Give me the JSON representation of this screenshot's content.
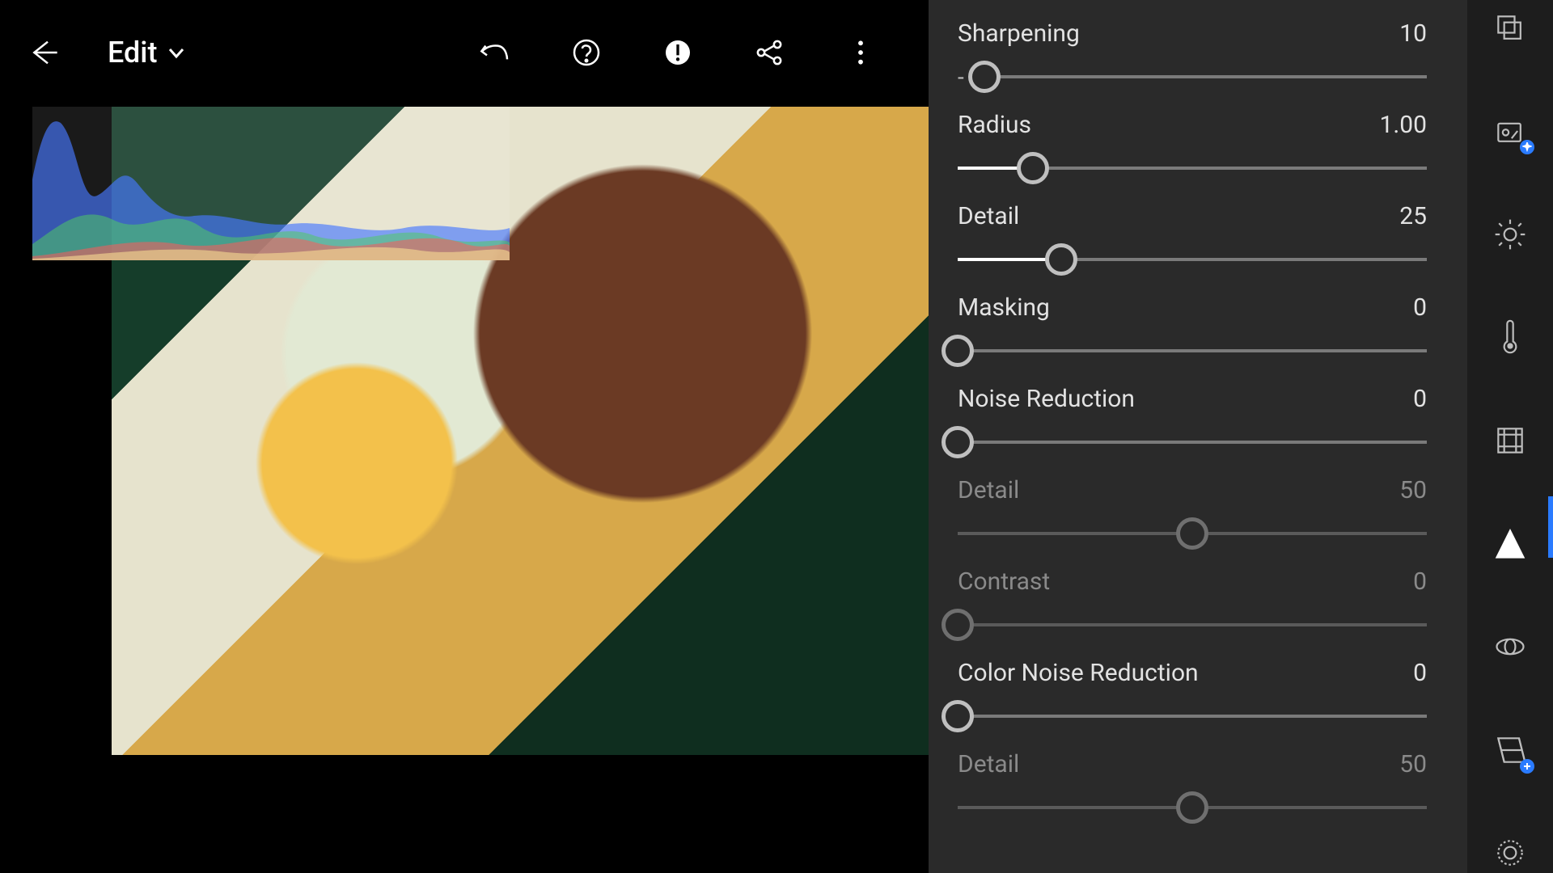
{
  "header": {
    "mode_label": "Edit"
  },
  "sliders": [
    {
      "id": "sharpening",
      "label": "Sharpening",
      "value": "10",
      "pct": 3,
      "fill_pct": 3,
      "has_neg": true,
      "disabled": false
    },
    {
      "id": "radius",
      "label": "Radius",
      "value": "1.00",
      "pct": 16,
      "fill_pct": 16,
      "has_neg": false,
      "disabled": false
    },
    {
      "id": "detail-sharp",
      "label": "Detail",
      "value": "25",
      "pct": 22,
      "fill_pct": 22,
      "has_neg": false,
      "disabled": false
    },
    {
      "id": "masking",
      "label": "Masking",
      "value": "0",
      "pct": 0,
      "fill_pct": 0,
      "has_neg": false,
      "disabled": false
    },
    {
      "id": "noise-reduction",
      "label": "Noise Reduction",
      "value": "0",
      "pct": 0,
      "fill_pct": 0,
      "has_neg": false,
      "disabled": false
    },
    {
      "id": "detail-nr",
      "label": "Detail",
      "value": "50",
      "pct": 50,
      "fill_pct": 0,
      "has_neg": false,
      "disabled": true
    },
    {
      "id": "contrast-nr",
      "label": "Contrast",
      "value": "0",
      "pct": 0,
      "fill_pct": 0,
      "has_neg": false,
      "disabled": true
    },
    {
      "id": "color-noise-reduction",
      "label": "Color Noise Reduction",
      "value": "0",
      "pct": 0,
      "fill_pct": 0,
      "has_neg": false,
      "disabled": false
    },
    {
      "id": "detail-cnr",
      "label": "Detail",
      "value": "50",
      "pct": 50,
      "fill_pct": 0,
      "has_neg": false,
      "disabled": true
    }
  ],
  "tools": [
    {
      "id": "filmstrip",
      "name": "filmstrip-icon",
      "active": false,
      "badge": null
    },
    {
      "id": "auto",
      "name": "auto-enhance-icon",
      "active": false,
      "badge": "sparkle"
    },
    {
      "id": "light",
      "name": "light-icon",
      "active": false,
      "badge": null
    },
    {
      "id": "color",
      "name": "color-temp-icon",
      "active": false,
      "badge": null
    },
    {
      "id": "crop",
      "name": "crop-icon",
      "active": false,
      "badge": null
    },
    {
      "id": "detail",
      "name": "detail-icon",
      "active": true,
      "badge": null
    },
    {
      "id": "optics",
      "name": "optics-icon",
      "active": false,
      "badge": null
    },
    {
      "id": "geometry",
      "name": "geometry-icon",
      "active": false,
      "badge": "plus"
    },
    {
      "id": "healing",
      "name": "healing-icon",
      "active": false,
      "badge": null
    }
  ]
}
